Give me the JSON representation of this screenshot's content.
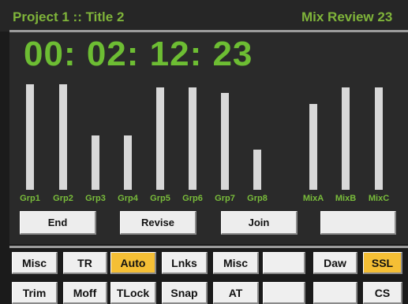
{
  "header": {
    "project": "Project 1 :: Title 2",
    "review": "Mix Review 23"
  },
  "timecode": "00: 02: 12: 23",
  "meters": [
    {
      "label": "Grp1",
      "level": 0.95
    },
    {
      "label": "Grp2",
      "level": 0.95
    },
    {
      "label": "Grp3",
      "level": 0.49
    },
    {
      "label": "Grp4",
      "level": 0.49
    },
    {
      "label": "Grp5",
      "level": 0.92
    },
    {
      "label": "Grp6",
      "level": 0.92
    },
    {
      "label": "Grp7",
      "level": 0.87
    },
    {
      "label": "Grp8",
      "level": 0.36
    },
    {
      "label": "MixA",
      "level": 0.77
    },
    {
      "label": "MixB",
      "level": 0.92
    },
    {
      "label": "MixC",
      "level": 0.92
    }
  ],
  "functions": [
    "End",
    "Revise",
    "Join",
    ""
  ],
  "keys_row1": [
    {
      "label": "Misc",
      "active": false
    },
    {
      "label": "TR",
      "active": false
    },
    {
      "label": "Auto",
      "active": true
    },
    {
      "label": "Lnks",
      "active": false
    },
    {
      "label": "Misc",
      "active": false
    },
    {
      "label": "",
      "active": false
    },
    {
      "label": "Daw",
      "active": false
    },
    {
      "label": "SSL",
      "active": true
    }
  ],
  "keys_row2": [
    {
      "label": "Trim",
      "active": false
    },
    {
      "label": "Moff",
      "active": false
    },
    {
      "label": "TLock",
      "active": false
    },
    {
      "label": "Snap",
      "active": false
    },
    {
      "label": "AT",
      "active": false
    },
    {
      "label": "",
      "active": false
    },
    {
      "label": "",
      "active": false
    },
    {
      "label": "CS",
      "active": false
    }
  ],
  "colors": {
    "accent_green": "#6dbd33",
    "active_key": "#f5bf35"
  }
}
